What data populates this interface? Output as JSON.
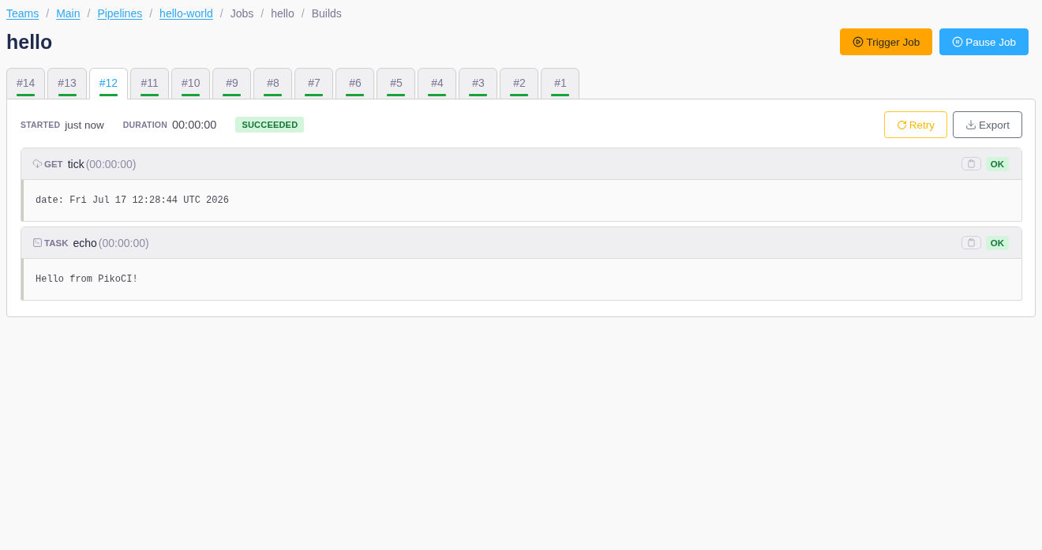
{
  "breadcrumbs": [
    {
      "kind": "link",
      "label": "Teams"
    },
    {
      "kind": "separator",
      "label": "/"
    },
    {
      "kind": "link",
      "label": "Main"
    },
    {
      "kind": "separator",
      "label": "/"
    },
    {
      "kind": "link",
      "label": "Pipelines"
    },
    {
      "kind": "separator",
      "label": "/"
    },
    {
      "kind": "link",
      "label": "hello-world"
    },
    {
      "kind": "separator",
      "label": "/"
    },
    {
      "kind": "text",
      "label": "Jobs"
    },
    {
      "kind": "separator",
      "label": "/"
    },
    {
      "kind": "text",
      "label": "hello"
    },
    {
      "kind": "separator",
      "label": "/"
    },
    {
      "kind": "text",
      "label": "Builds"
    }
  ],
  "title": "hello",
  "actions": [
    {
      "kind": "trigger",
      "label": "Trigger Job"
    },
    {
      "kind": "pause",
      "label": "Pause Job"
    }
  ],
  "build_tabs": [
    {
      "label": "#14",
      "selected": false,
      "color": "#17a23a"
    },
    {
      "label": "#13",
      "selected": false,
      "color": "#17a23a"
    },
    {
      "label": "#12",
      "selected": true,
      "color": "#17a23a"
    },
    {
      "label": "#11",
      "selected": false,
      "color": "#17a23a"
    },
    {
      "label": "#10",
      "selected": false,
      "color": "#17a23a"
    },
    {
      "label": "#9",
      "selected": false,
      "color": "#17a23a"
    },
    {
      "label": "#8",
      "selected": false,
      "color": "#17a23a"
    },
    {
      "label": "#7",
      "selected": false,
      "color": "#17a23a"
    },
    {
      "label": "#6",
      "selected": false,
      "color": "#17a23a"
    },
    {
      "label": "#5",
      "selected": false,
      "color": "#17a23a"
    },
    {
      "label": "#4",
      "selected": false,
      "color": "#17a23a"
    },
    {
      "label": "#3",
      "selected": false,
      "color": "#17a23a"
    },
    {
      "label": "#2",
      "selected": false,
      "color": "#17a23a"
    },
    {
      "label": "#1",
      "selected": false,
      "color": "#17a23a"
    }
  ],
  "build": {
    "meta": [
      {
        "label": "STARTED",
        "value": "just now"
      },
      {
        "label": "DURATION",
        "value": "00:00:00"
      }
    ],
    "status": "SUCCEEDED",
    "actions": [
      {
        "kind": "retry",
        "label": "Retry"
      },
      {
        "kind": "export",
        "label": "Export"
      }
    ],
    "steps": [
      {
        "kind": "get",
        "type": "GET",
        "name": "tick",
        "duration": "(00:00:00)",
        "status": "OK",
        "output": "date: Fri Jul 17 12:28:44 UTC 2026"
      },
      {
        "kind": "task",
        "type": "TASK",
        "name": "echo",
        "duration": "(00:00:00)",
        "status": "OK",
        "output": "Hello from PikoCI!"
      }
    ]
  }
}
